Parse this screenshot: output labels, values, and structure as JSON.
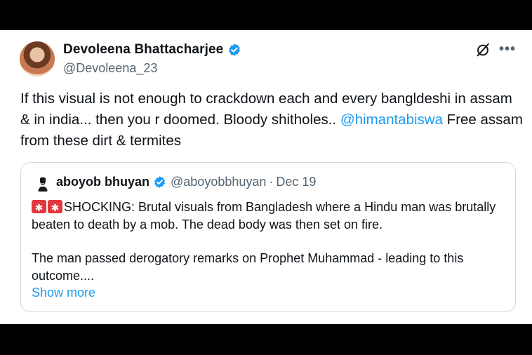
{
  "post": {
    "display_name": "Devoleena Bhattacharjee",
    "handle": "@Devoleena_23",
    "text_before": "If this visual is not enough to crackdown each and every bangldeshi in assam & in india... then you r doomed. Bloody shitholes.. ",
    "mention": "@himantabiswa",
    "text_after": " Free assam from these dirt & termites"
  },
  "quoted": {
    "display_name": "aboyob bhuyan",
    "handle": "@aboyobbhuyan",
    "separator": "·",
    "date": "Dec 19",
    "line1": "SHOCKING: Brutal visuals from Bangladesh where a Hindu man was brutally beaten to death by a mob. The dead body was then set on fire.",
    "line2": "The man passed derogatory remarks on Prophet Muhammad - leading to this outcome....",
    "show_more": "Show more"
  },
  "icons": {
    "verified": "verified-badge-icon",
    "grok": "grok-icon",
    "more": "more-icon",
    "siren": "police-light-icon"
  },
  "colors": {
    "link": "#1d9bf0",
    "secondary_text": "#536471",
    "verified": "#1d9bf0",
    "siren": "#e0383e"
  }
}
